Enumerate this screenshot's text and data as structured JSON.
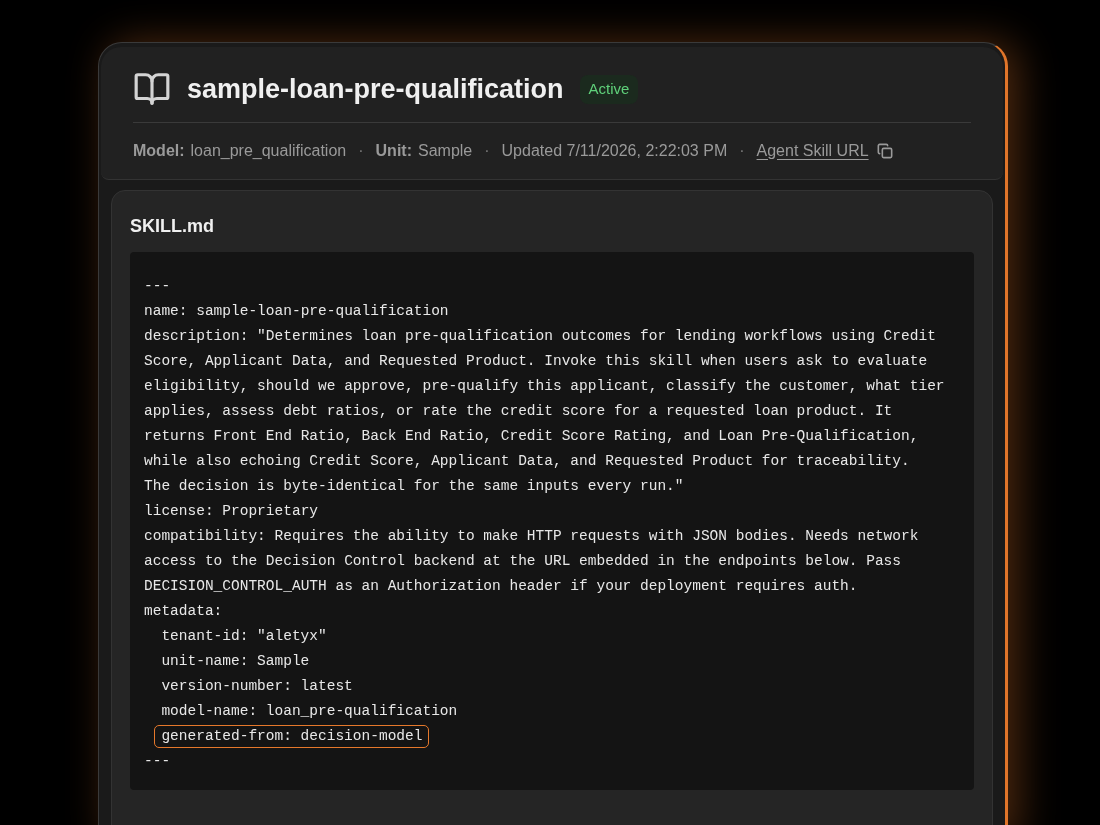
{
  "header": {
    "title": "sample-loan-pre-qualification",
    "status": {
      "label": "Active",
      "kind": "active"
    },
    "meta": [
      {
        "kind": "field",
        "label": "Model:",
        "value": "loan_pre_qualification"
      },
      {
        "kind": "separator",
        "text": "·"
      },
      {
        "kind": "field",
        "label": "Unit:",
        "value": "Sample"
      },
      {
        "kind": "separator",
        "text": "·"
      },
      {
        "kind": "text",
        "text": "Updated 7/11/2026, 2:22:03 PM"
      },
      {
        "kind": "separator",
        "text": "·"
      },
      {
        "kind": "link",
        "text": "Agent Skill URL"
      }
    ]
  },
  "skill_file": {
    "title": "SKILL.md",
    "lines": [
      {
        "text": "---",
        "highlighted": false
      },
      {
        "text": "name: sample-loan-pre-qualification",
        "highlighted": false
      },
      {
        "text": "description: \"Determines loan pre-qualification outcomes for lending workflows using Credit",
        "highlighted": false
      },
      {
        "text": "Score, Applicant Data, and Requested Product. Invoke this skill when users ask to evaluate",
        "highlighted": false
      },
      {
        "text": "eligibility, should we approve, pre-qualify this applicant, classify the customer, what tier",
        "highlighted": false
      },
      {
        "text": "applies, assess debt ratios, or rate the credit score for a requested loan product. It",
        "highlighted": false
      },
      {
        "text": "returns Front End Ratio, Back End Ratio, Credit Score Rating, and Loan Pre-Qualification,",
        "highlighted": false
      },
      {
        "text": "while also echoing Credit Score, Applicant Data, and Requested Product for traceability.",
        "highlighted": false
      },
      {
        "text": "The decision is byte-identical for the same inputs every run.\"",
        "highlighted": false
      },
      {
        "text": "license: Proprietary",
        "highlighted": false
      },
      {
        "text": "compatibility: Requires the ability to make HTTP requests with JSON bodies. Needs network",
        "highlighted": false
      },
      {
        "text": "access to the Decision Control backend at the URL embedded in the endpoints below. Pass",
        "highlighted": false
      },
      {
        "text": "DECISION_CONTROL_AUTH as an Authorization header if your deployment requires auth.",
        "highlighted": false
      },
      {
        "text": "metadata:",
        "highlighted": false,
        "children": [
          {
            "text": "tenant-id: \"aletyx\"",
            "highlighted": false
          },
          {
            "text": "unit-name: Sample",
            "highlighted": false
          },
          {
            "text": "version-number: latest",
            "highlighted": false
          },
          {
            "text": "model-name: loan_pre-qualification",
            "highlighted": false
          },
          {
            "text": "generated-from: decision-model",
            "highlighted": true
          }
        ]
      },
      {
        "text": "---",
        "highlighted": false
      }
    ]
  }
}
